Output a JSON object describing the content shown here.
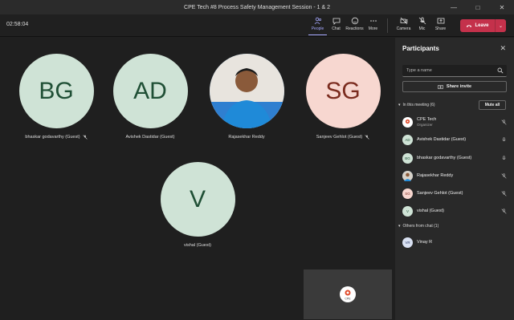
{
  "window": {
    "title": "CPE Tech #8 Process Safety Management Session - 1 & 2",
    "controls": [
      "—",
      "□",
      "✕"
    ]
  },
  "toolbar": {
    "timer": "02:58:04",
    "items": [
      {
        "label": "People",
        "icon": "people-icon",
        "active": true
      },
      {
        "label": "Chat",
        "icon": "chat-icon"
      },
      {
        "label": "Reactions",
        "icon": "reactions-icon"
      },
      {
        "label": "More",
        "icon": "more-icon"
      },
      {
        "label": "Camera",
        "icon": "camera-off-icon"
      },
      {
        "label": "Mic",
        "icon": "mic-off-icon"
      },
      {
        "label": "Share",
        "icon": "share-icon"
      }
    ],
    "leave_label": "Leave",
    "leave_color": "#c4314b"
  },
  "stage": {
    "tiles": [
      {
        "initials": "BG",
        "name": "bhaskar godavarthy (Guest)",
        "muted": true,
        "style": "green"
      },
      {
        "initials": "AD",
        "name": "Avishek Dastidar (Guest)",
        "muted": false,
        "style": "green"
      },
      {
        "initials": "",
        "name": "Rajasekhar Reddy",
        "muted": false,
        "style": "photo"
      },
      {
        "initials": "SG",
        "name": "Sanjeev Gehlot (Guest)",
        "muted": true,
        "style": "pink"
      },
      {
        "initials": "V",
        "name": "vishal (Guest)",
        "muted": false,
        "style": "green"
      }
    ],
    "self_view_logo_text": "CPE"
  },
  "panel": {
    "title": "Participants",
    "search_placeholder": "Type a name",
    "share_invite_label": "Share invite",
    "in_meeting_label": "In this meeting (6)",
    "mute_all_label": "Mute all",
    "participants": [
      {
        "name": "CPE Tech",
        "role": "Organizer",
        "avatar": "logo",
        "mic": "muted"
      },
      {
        "name": "Avishek Dastidar (Guest)",
        "avatar": "AD",
        "mic": "on"
      },
      {
        "name": "bhaskar godavarthy (Guest)",
        "avatar": "BG",
        "mic": "on"
      },
      {
        "name": "Rajasekhar Reddy",
        "avatar": "photo",
        "mic": "muted"
      },
      {
        "name": "Sanjeev Gehlot (Guest)",
        "avatar": "SG",
        "mic": "muted"
      },
      {
        "name": "vishal (Guest)",
        "avatar": "V",
        "mic": "muted"
      }
    ],
    "others_label": "Others from chat (1)",
    "others": [
      {
        "name": "Vinay R",
        "avatar": "VR"
      }
    ]
  }
}
